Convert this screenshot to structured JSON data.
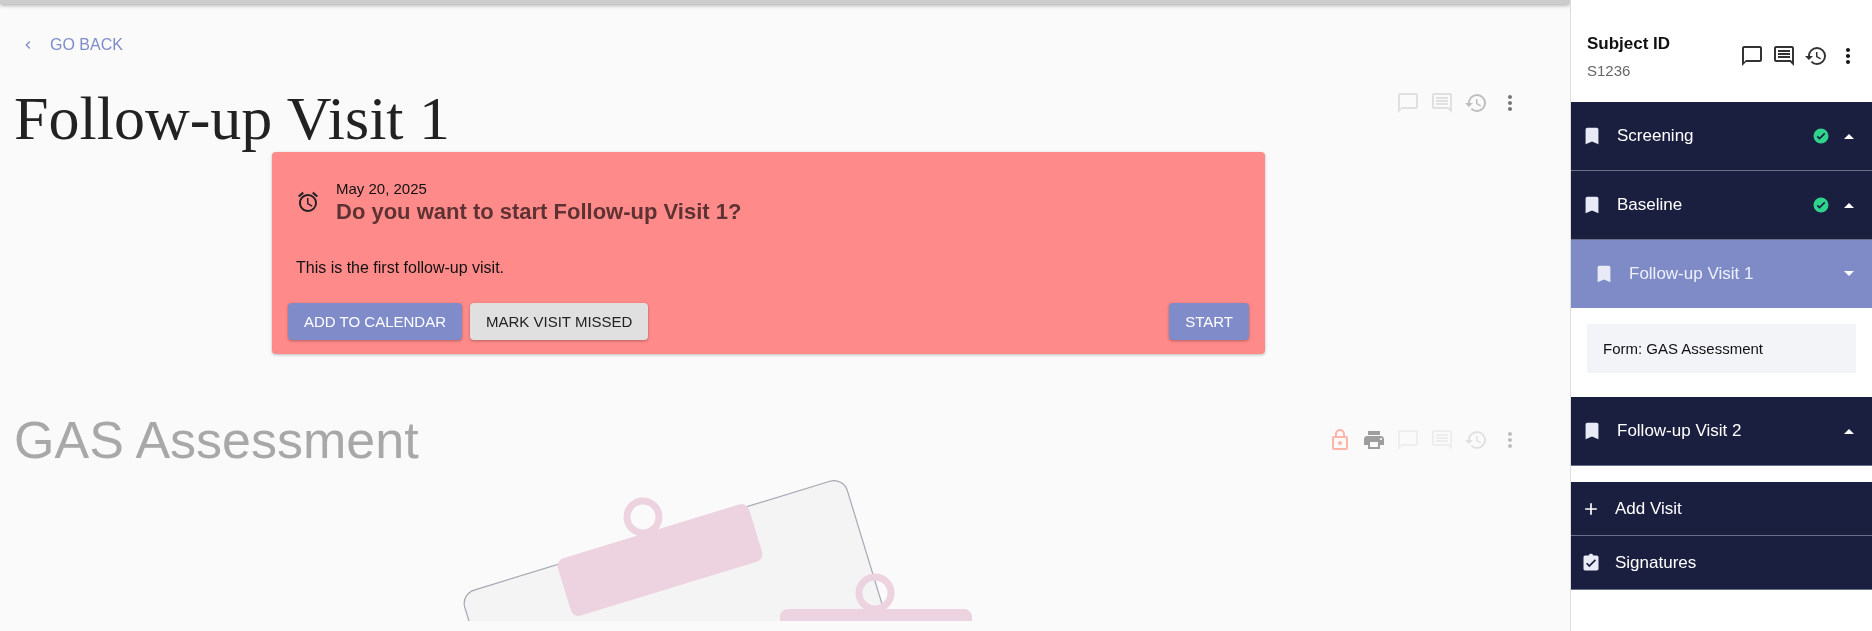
{
  "back_link": {
    "label": "GO BACK"
  },
  "page_title": "Follow-up Visit 1",
  "prompt_card": {
    "date": "May 20, 2025",
    "title": "Do you want to start Follow-up Visit 1?",
    "message": "This is the first follow-up visit.",
    "buttons": [
      {
        "label": "ADD TO CALENDAR",
        "kind": "primary"
      },
      {
        "label": "MARK VISIT MISSED",
        "kind": "secondary"
      },
      {
        "label": "START",
        "kind": "primary"
      }
    ]
  },
  "form_section": {
    "title": "GAS Assessment",
    "locked": true
  },
  "sidebar": {
    "subject_label": "Subject ID",
    "subject_id": "S1236",
    "visits": [
      {
        "name": "Screening",
        "completed": true,
        "selected": false,
        "expanded": false
      },
      {
        "name": "Baseline",
        "completed": true,
        "selected": false,
        "expanded": false
      },
      {
        "name": "Follow-up Visit 1",
        "completed": false,
        "selected": true,
        "expanded": true,
        "forms": [
          "Form: GAS Assessment"
        ]
      },
      {
        "name": "Follow-up Visit 2",
        "completed": false,
        "selected": false,
        "expanded": false
      }
    ],
    "actions": [
      {
        "label": "Add Visit",
        "kind": "add"
      },
      {
        "label": "Signatures",
        "kind": "signatures"
      }
    ]
  }
}
